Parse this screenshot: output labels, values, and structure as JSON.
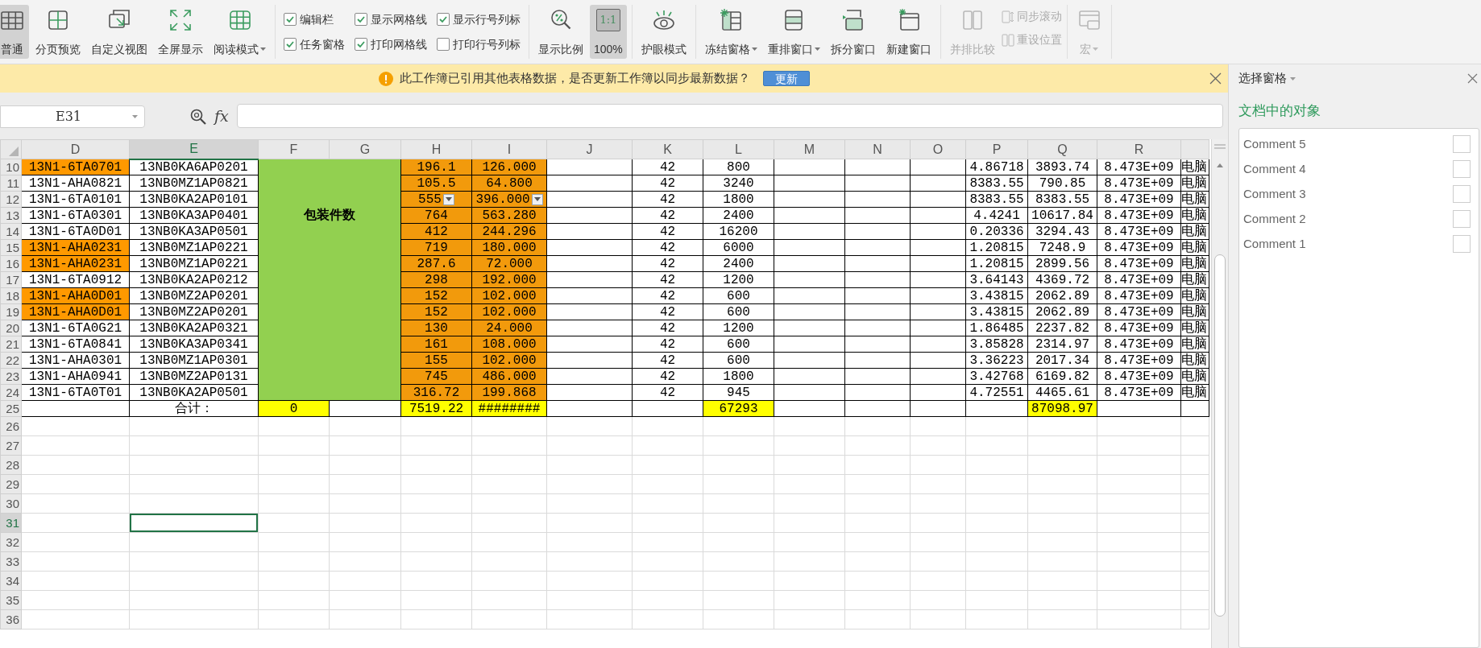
{
  "ribbon": {
    "groups": [
      {
        "items": [
          {
            "kind": "button",
            "label": "普通",
            "selected": true,
            "disabled": false,
            "dropdown": false
          },
          {
            "kind": "button",
            "label": "分页预览",
            "selected": false,
            "disabled": false,
            "dropdown": false
          },
          {
            "kind": "button",
            "label": "自定义视图",
            "selected": false,
            "disabled": false,
            "dropdown": false
          },
          {
            "kind": "button",
            "label": "全屏显示",
            "selected": false,
            "disabled": false,
            "dropdown": false
          },
          {
            "kind": "button",
            "label": "阅读模式",
            "selected": false,
            "disabled": false,
            "dropdown": true
          }
        ]
      },
      {
        "items": [
          {
            "kind": "checkbox",
            "label": "编辑栏",
            "checked": true
          },
          {
            "kind": "checkbox",
            "label": "显示网格线",
            "checked": true
          },
          {
            "kind": "checkbox",
            "label": "显示行号列标",
            "checked": true
          },
          {
            "kind": "checkbox",
            "label": "任务窗格",
            "checked": true
          },
          {
            "kind": "checkbox",
            "label": "打印网格线",
            "checked": true
          },
          {
            "kind": "checkbox",
            "label": "打印行号列标",
            "checked": false
          }
        ]
      },
      {
        "items": [
          {
            "kind": "button",
            "label": "显示比例",
            "selected": false,
            "disabled": false,
            "dropdown": false
          },
          {
            "kind": "button",
            "label": "100%",
            "icon_text": "1:1",
            "selected": true,
            "disabled": false,
            "dropdown": false
          }
        ]
      },
      {
        "items": [
          {
            "kind": "button",
            "label": "护眼模式",
            "selected": false,
            "disabled": false,
            "dropdown": false
          }
        ]
      },
      {
        "items": [
          {
            "kind": "button",
            "label": "冻结窗格",
            "selected": false,
            "disabled": false,
            "dropdown": true
          },
          {
            "kind": "button",
            "label": "重排窗口",
            "selected": false,
            "disabled": false,
            "dropdown": true
          },
          {
            "kind": "button",
            "label": "拆分窗口",
            "selected": false,
            "disabled": false,
            "dropdown": false
          },
          {
            "kind": "button",
            "label": "新建窗口",
            "selected": false,
            "disabled": false,
            "dropdown": false
          }
        ]
      },
      {
        "items": [
          {
            "kind": "button",
            "label": "并排比较",
            "selected": false,
            "disabled": true,
            "dropdown": false
          },
          {
            "kind": "small",
            "label": "同步滚动",
            "disabled": true
          },
          {
            "kind": "small",
            "label": "重设位置",
            "disabled": true
          }
        ]
      },
      {
        "items": [
          {
            "kind": "button",
            "label": "宏",
            "selected": false,
            "disabled": true,
            "dropdown": true
          }
        ]
      }
    ]
  },
  "notice": {
    "text": "此工作簿已引用其他表格数据，是否更新工作簿以同步最新数据？",
    "button": "更新"
  },
  "formula_bar": {
    "cell_ref": "E31",
    "fx_label": "fx"
  },
  "sheet": {
    "columns": [
      {
        "label": "D",
        "selected": false
      },
      {
        "label": "E",
        "selected": true
      },
      {
        "label": "F",
        "selected": false
      },
      {
        "label": "G",
        "selected": false
      },
      {
        "label": "H",
        "selected": false
      },
      {
        "label": "I",
        "selected": false
      },
      {
        "label": "J",
        "selected": false
      },
      {
        "label": "K",
        "selected": false
      },
      {
        "label": "L",
        "selected": false
      },
      {
        "label": "M",
        "selected": false
      },
      {
        "label": "N",
        "selected": false
      },
      {
        "label": "O",
        "selected": false
      },
      {
        "label": "P",
        "selected": false
      },
      {
        "label": "Q",
        "selected": false
      },
      {
        "label": "R",
        "selected": false
      },
      {
        "selected": false
      }
    ],
    "rows": [
      {
        "number": "10",
        "selected": false,
        "cells": [
          {
            "text": "13N1-6TA0701",
            "color": "#ff9900"
          },
          {
            "text": "13NB0KA6AP0201"
          },
          {
            "text": "包装件数",
            "color": "#92d050",
            "merged": true
          },
          {},
          {
            "text": "196.1",
            "color": "#f29a0c"
          },
          {
            "text": "126.000",
            "color": "#f29a0c"
          },
          {},
          {
            "text": "42"
          },
          {
            "text": "800"
          },
          {},
          {},
          {},
          {
            "text": "4.86718"
          },
          {
            "text": "3893.74"
          },
          {
            "text": "8.473E+09"
          },
          {
            "text": "电脑"
          }
        ]
      },
      {
        "number": "11",
        "selected": false,
        "cells": [
          {
            "text": "13N1-AHA0821"
          },
          {
            "text": "13NB0MZ1AP0821"
          },
          {},
          {},
          {
            "text": "105.5",
            "color": "#f29a0c"
          },
          {
            "text": "64.800",
            "color": "#f29a0c"
          },
          {},
          {
            "text": "42"
          },
          {
            "text": "3240"
          },
          {},
          {},
          {},
          {
            "text": "8383.55"
          },
          {
            "text": "790.85"
          },
          {
            "text": "8.473E+09"
          },
          {
            "text": "电脑"
          }
        ]
      },
      {
        "number": "12",
        "selected": false,
        "cells": [
          {
            "text": "13N1-6TA0101"
          },
          {
            "text": "13NB0KA2AP0101"
          },
          {},
          {},
          {
            "text": "555",
            "color": "#f29a0c",
            "dropdown": true
          },
          {
            "text": "396.000",
            "color": "#f29a0c",
            "dropdown": true
          },
          {},
          {
            "text": "42"
          },
          {
            "text": "1800"
          },
          {},
          {},
          {},
          {
            "text": "8383.55"
          },
          {
            "text": "8383.55"
          },
          {
            "text": "8.473E+09"
          },
          {
            "text": "电脑"
          }
        ]
      },
      {
        "number": "13",
        "selected": false,
        "cells": [
          {
            "text": "13N1-6TA0301"
          },
          {
            "text": "13NB0KA3AP0401"
          },
          {},
          {},
          {
            "text": "764",
            "color": "#f29a0c"
          },
          {
            "text": "563.280",
            "color": "#f29a0c"
          },
          {},
          {
            "text": "42"
          },
          {
            "text": "2400"
          },
          {},
          {},
          {},
          {
            "text": "4.4241"
          },
          {
            "text": "10617.84"
          },
          {
            "text": "8.473E+09"
          },
          {
            "text": "电脑"
          }
        ]
      },
      {
        "number": "14",
        "selected": false,
        "cells": [
          {
            "text": "13N1-6TA0D01"
          },
          {
            "text": "13NB0KA3AP0501"
          },
          {},
          {},
          {
            "text": "412",
            "color": "#f29a0c"
          },
          {
            "text": "244.296",
            "color": "#f29a0c"
          },
          {},
          {
            "text": "42"
          },
          {
            "text": "16200"
          },
          {},
          {},
          {},
          {
            "text": "0.20336"
          },
          {
            "text": "3294.43"
          },
          {
            "text": "8.473E+09"
          },
          {
            "text": "电脑"
          }
        ]
      },
      {
        "number": "15",
        "selected": false,
        "cells": [
          {
            "text": "13N1-AHA0231",
            "color": "#ff9900"
          },
          {
            "text": "13NB0MZ1AP0221"
          },
          {},
          {},
          {
            "text": "719",
            "color": "#f29a0c"
          },
          {
            "text": "180.000",
            "color": "#f29a0c"
          },
          {},
          {
            "text": "42"
          },
          {
            "text": "6000"
          },
          {},
          {},
          {},
          {
            "text": "1.20815"
          },
          {
            "text": "7248.9"
          },
          {
            "text": "8.473E+09"
          },
          {
            "text": "电脑"
          }
        ]
      },
      {
        "number": "16",
        "selected": false,
        "cells": [
          {
            "text": "13N1-AHA0231",
            "color": "#ff9900"
          },
          {
            "text": "13NB0MZ1AP0221"
          },
          {},
          {},
          {
            "text": "287.6",
            "color": "#f29a0c"
          },
          {
            "text": "72.000",
            "color": "#f29a0c"
          },
          {},
          {
            "text": "42"
          },
          {
            "text": "2400"
          },
          {},
          {},
          {},
          {
            "text": "1.20815"
          },
          {
            "text": "2899.56"
          },
          {
            "text": "8.473E+09"
          },
          {
            "text": "电脑"
          }
        ]
      },
      {
        "number": "17",
        "selected": false,
        "cells": [
          {
            "text": "13N1-6TA0912"
          },
          {
            "text": "13NB0KA2AP0212"
          },
          {},
          {},
          {
            "text": "298",
            "color": "#f29a0c"
          },
          {
            "text": "192.000",
            "color": "#f29a0c"
          },
          {},
          {
            "text": "42"
          },
          {
            "text": "1200"
          },
          {},
          {},
          {},
          {
            "text": "3.64143"
          },
          {
            "text": "4369.72"
          },
          {
            "text": "8.473E+09"
          },
          {
            "text": "电脑"
          }
        ]
      },
      {
        "number": "18",
        "selected": false,
        "cells": [
          {
            "text": "13N1-AHA0D01",
            "color": "#ff9900"
          },
          {
            "text": "13NB0MZ2AP0201"
          },
          {},
          {},
          {
            "text": "152",
            "color": "#f29a0c"
          },
          {
            "text": "102.000",
            "color": "#f29a0c"
          },
          {},
          {
            "text": "42"
          },
          {
            "text": "600"
          },
          {},
          {},
          {},
          {
            "text": "3.43815"
          },
          {
            "text": "2062.89"
          },
          {
            "text": "8.473E+09"
          },
          {
            "text": "电脑"
          }
        ]
      },
      {
        "number": "19",
        "selected": false,
        "cells": [
          {
            "text": "13N1-AHA0D01",
            "color": "#ff9900"
          },
          {
            "text": "13NB0MZ2AP0201"
          },
          {},
          {},
          {
            "text": "152",
            "color": "#f29a0c"
          },
          {
            "text": "102.000",
            "color": "#f29a0c"
          },
          {},
          {
            "text": "42"
          },
          {
            "text": "600"
          },
          {},
          {},
          {},
          {
            "text": "3.43815"
          },
          {
            "text": "2062.89"
          },
          {
            "text": "8.473E+09"
          },
          {
            "text": "电脑"
          }
        ]
      },
      {
        "number": "20",
        "selected": false,
        "cells": [
          {
            "text": "13N1-6TA0G21"
          },
          {
            "text": "13NB0KA2AP0321"
          },
          {},
          {},
          {
            "text": "130",
            "color": "#f29a0c"
          },
          {
            "text": "24.000",
            "color": "#f29a0c"
          },
          {},
          {
            "text": "42"
          },
          {
            "text": "1200"
          },
          {},
          {},
          {},
          {
            "text": "1.86485"
          },
          {
            "text": "2237.82"
          },
          {
            "text": "8.473E+09"
          },
          {
            "text": "电脑"
          }
        ]
      },
      {
        "number": "21",
        "selected": false,
        "cells": [
          {
            "text": "13N1-6TA0841"
          },
          {
            "text": "13NB0KA3AP0341"
          },
          {},
          {},
          {
            "text": "161",
            "color": "#f29a0c"
          },
          {
            "text": "108.000",
            "color": "#f29a0c"
          },
          {},
          {
            "text": "42"
          },
          {
            "text": "600"
          },
          {},
          {},
          {},
          {
            "text": "3.85828"
          },
          {
            "text": "2314.97"
          },
          {
            "text": "8.473E+09"
          },
          {
            "text": "电脑"
          }
        ]
      },
      {
        "number": "22",
        "selected": false,
        "cells": [
          {
            "text": "13N1-AHA0301"
          },
          {
            "text": "13NB0MZ1AP0301"
          },
          {},
          {},
          {
            "text": "155",
            "color": "#f29a0c"
          },
          {
            "text": "102.000",
            "color": "#f29a0c"
          },
          {},
          {
            "text": "42"
          },
          {
            "text": "600"
          },
          {},
          {},
          {},
          {
            "text": "3.36223"
          },
          {
            "text": "2017.34"
          },
          {
            "text": "8.473E+09"
          },
          {
            "text": "电脑"
          }
        ]
      },
      {
        "number": "23",
        "selected": false,
        "cells": [
          {
            "text": "13N1-AHA0941"
          },
          {
            "text": "13NB0MZ2AP0131"
          },
          {},
          {},
          {
            "text": "745",
            "color": "#f29a0c"
          },
          {
            "text": "486.000",
            "color": "#f29a0c"
          },
          {},
          {
            "text": "42"
          },
          {
            "text": "1800"
          },
          {},
          {},
          {},
          {
            "text": "3.42768"
          },
          {
            "text": "6169.82"
          },
          {
            "text": "8.473E+09"
          },
          {
            "text": "电脑"
          }
        ]
      },
      {
        "number": "24",
        "selected": false,
        "cells": [
          {
            "text": "13N1-6TA0T01"
          },
          {
            "text": "13NB0KA2AP0501"
          },
          {},
          {},
          {
            "text": "316.72",
            "color": "#f29a0c"
          },
          {
            "text": "199.868",
            "color": "#f29a0c"
          },
          {},
          {
            "text": "42"
          },
          {
            "text": "945"
          },
          {},
          {},
          {},
          {
            "text": "4.72551"
          },
          {
            "text": "4465.61"
          },
          {
            "text": "8.473E+09"
          },
          {
            "text": "电脑"
          }
        ]
      },
      {
        "number": "25",
        "selected": false,
        "cells": [
          {},
          {
            "text": "合计："
          },
          {
            "text": "0",
            "color": "#ffff00"
          },
          {},
          {
            "text": "7519.22",
            "color": "#ffff00"
          },
          {
            "text": "########",
            "color": "#ffff00"
          },
          {},
          {},
          {
            "text": "67293",
            "color": "#ffff00"
          },
          {},
          {},
          {},
          {},
          {
            "text": "87098.97",
            "color": "#ffff00"
          },
          {},
          {}
        ]
      },
      {
        "number": "26",
        "selected": false
      },
      {
        "number": "27",
        "selected": false
      },
      {
        "number": "28",
        "selected": false
      },
      {
        "number": "29",
        "selected": false
      },
      {
        "number": "30",
        "selected": false
      },
      {
        "number": "31",
        "selected": true
      },
      {
        "number": "32",
        "selected": false
      },
      {
        "number": "33",
        "selected": false
      },
      {
        "number": "34",
        "selected": false
      },
      {
        "number": "35",
        "selected": false
      },
      {
        "number": "36",
        "selected": false
      }
    ]
  },
  "selection_pane": {
    "title": "选择窗格",
    "heading": "文档中的对象",
    "objects": [
      {
        "name": "Comment 5",
        "checked": false
      },
      {
        "name": "Comment 4",
        "checked": false
      },
      {
        "name": "Comment 3",
        "checked": false
      },
      {
        "name": "Comment 2",
        "checked": false
      },
      {
        "name": "Comment 1",
        "checked": false
      }
    ]
  }
}
